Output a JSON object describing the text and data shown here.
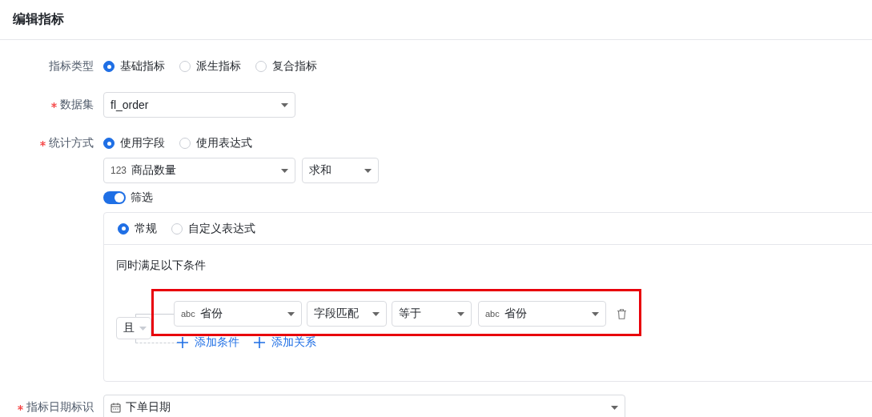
{
  "header": {
    "title": "编辑指标"
  },
  "metric_type": {
    "label": "指标类型",
    "required": false,
    "options": [
      {
        "label": "基础指标",
        "selected": true
      },
      {
        "label": "派生指标",
        "selected": false
      },
      {
        "label": "复合指标",
        "selected": false
      }
    ]
  },
  "dataset": {
    "label": "数据集",
    "required": true,
    "value": "fl_order"
  },
  "stat_method": {
    "label": "统计方式",
    "required": true,
    "options": [
      {
        "label": "使用字段",
        "selected": true
      },
      {
        "label": "使用表达式",
        "selected": false
      }
    ],
    "field": {
      "type_tag": "123",
      "value": "商品数量"
    },
    "aggregation": {
      "value": "求和"
    },
    "filter": {
      "label": "筛选",
      "on": true
    }
  },
  "filter_panel": {
    "modes": [
      {
        "label": "常规",
        "selected": true
      },
      {
        "label": "自定义表达式",
        "selected": false
      }
    ],
    "hint": "同时满足以下条件",
    "logic": {
      "value": "且"
    },
    "condition": {
      "highlighted": true,
      "field": {
        "type_tag": "abc",
        "value": "省份"
      },
      "match": {
        "value": "字段匹配"
      },
      "operator": {
        "value": "等于"
      },
      "target": {
        "type_tag": "abc",
        "value": "省份"
      }
    },
    "actions": [
      {
        "label": "添加条件"
      },
      {
        "label": "添加关系"
      }
    ]
  },
  "date_field": {
    "label": "指标日期标识",
    "required": true,
    "value": "下单日期"
  }
}
